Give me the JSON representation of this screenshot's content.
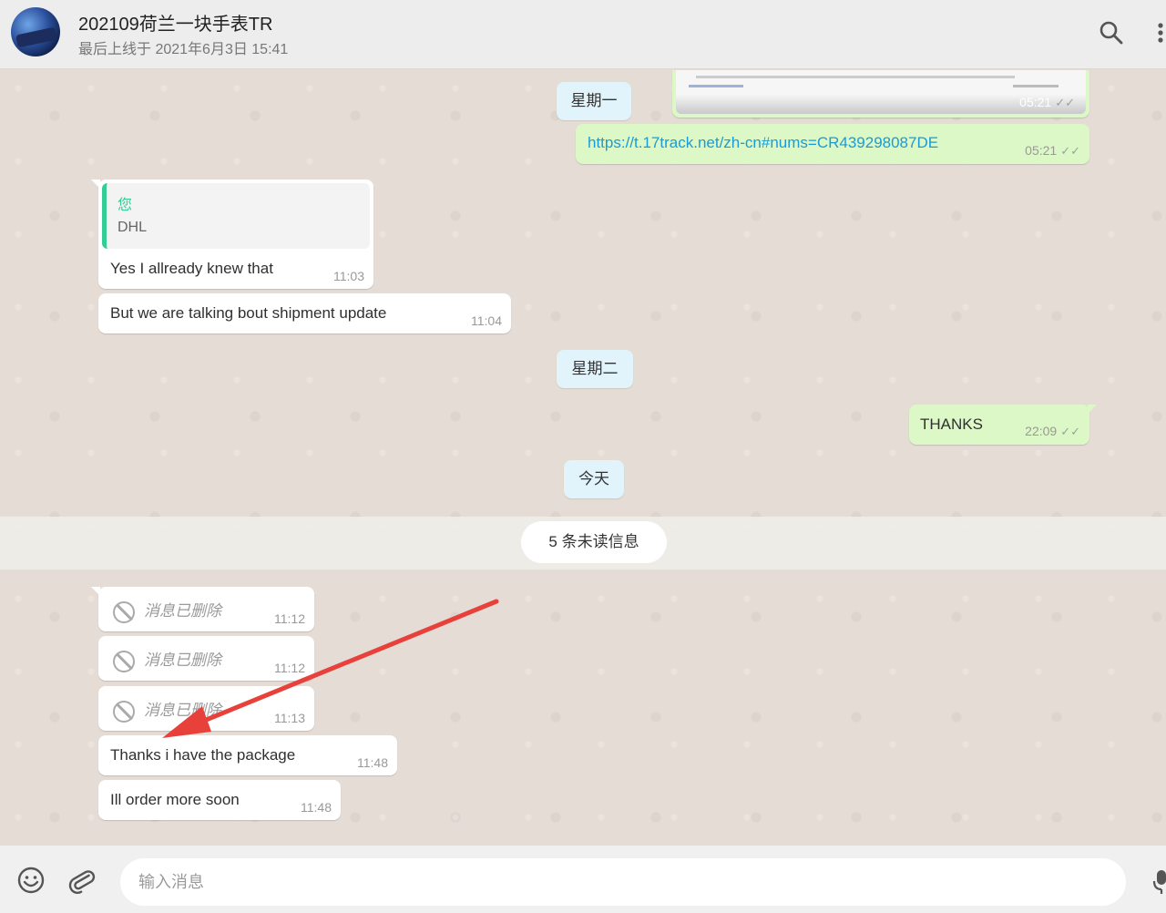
{
  "header": {
    "title": "202109荷兰一块手表TR",
    "subtitle": "最后上线于 2021年6月3日 15:41",
    "icons": [
      "search-icon",
      "more-vertical-icon"
    ]
  },
  "messages": {
    "image_time": "05:21",
    "link_text": "https://t.17track.net/zh-cn#nums=CR439298087DE",
    "link_time": "05:21",
    "reply_quote_author": "您",
    "reply_quote_text": "DHL",
    "reply_text": "Yes I allready knew that",
    "reply_time": "11:03",
    "shipment_text": "But we are talking bout shipment update",
    "shipment_time": "11:04",
    "thanks_text": "THANKS",
    "thanks_time": "22:09",
    "deleted_label": "消息已删除",
    "deleted_times": [
      "11:12",
      "11:12",
      "11:13"
    ],
    "package_text": "Thanks i have the package",
    "package_time": "11:48",
    "order_text": "Ill order more soon",
    "order_time": "11:48"
  },
  "days": {
    "monday": "星期一",
    "tuesday": "星期二",
    "today": "今天"
  },
  "unread": "5 条未读信息",
  "footer": {
    "placeholder": "输入消息",
    "icons": [
      "emoji-icon",
      "attach-icon",
      "mic-icon"
    ]
  },
  "colors": {
    "incoming": "#ffffff",
    "outgoing": "#dcf8c6",
    "day_pill": "#e1f3fb",
    "link": "#1a9bd7",
    "quote_bar": "#35cd96",
    "annotation_arrow": "#e8413b"
  }
}
